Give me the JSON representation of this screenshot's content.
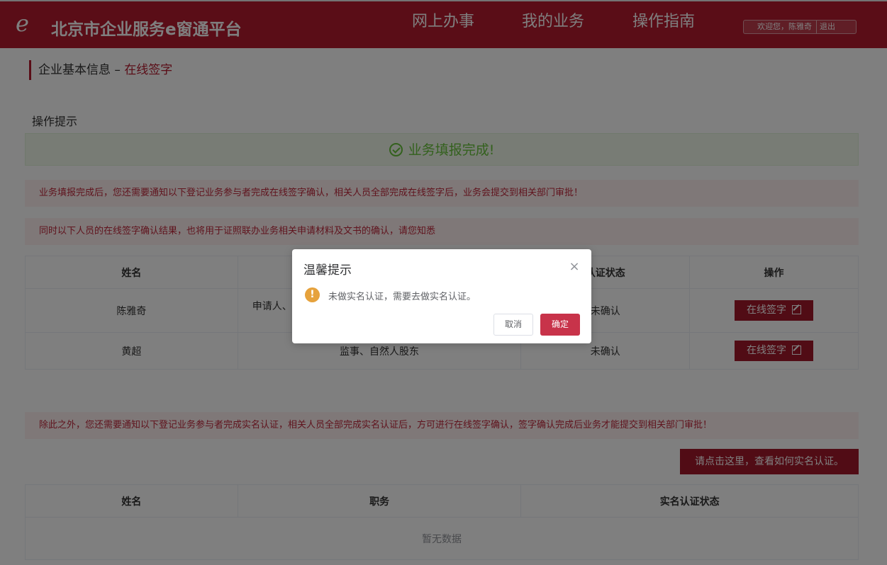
{
  "header": {
    "logo_text": "e",
    "brand": "北京市企业服务e窗通平台",
    "nav": [
      "网上办事",
      "我的业务",
      "操作指南"
    ],
    "welcome": "欢迎您，陈雅奇",
    "logout": "退出"
  },
  "page": {
    "title": "企业基本信息 – ",
    "subtitle": "在线签字",
    "hint_title": "操作提示",
    "success": "业务填报完成!",
    "notice1": "业务填报完成后，您还需要通知以下登记业务参与者完成在线签字确认，相关人员全部完成在线签字后，业务会提交到相关部门审批！",
    "notice2": "同时以下人员的在线签字确认结果，也将用于证照联办业务相关申请材料及文书的确认，请您知悉",
    "notice3": "除此之外，您还需要通知以下登记业务参与者完成实名认证，相关人员全部完成实名认证后，方可进行在线签字确认，签字确认完成后业务才能提交到相关部门审批！",
    "howto_button": "请点击这里，查看如何实名认证。"
  },
  "sign_table": {
    "headers": [
      "姓名",
      "",
      "认证状态",
      "操作"
    ],
    "rows": [
      {
        "name": "陈雅奇",
        "role": "申请人、纟",
        "status": "未确认",
        "action": "在线签字"
      },
      {
        "name": "黄超",
        "role": "监事、自然人股东",
        "status": "未确认",
        "action": "在线签字"
      }
    ]
  },
  "auth_table": {
    "headers": [
      "姓名",
      "职务",
      "实名认证状态"
    ],
    "empty": "暂无数据"
  },
  "dialog": {
    "title": "温馨提示",
    "close": "×",
    "warn_icon": "!",
    "message": "未做实名认证，需要去做实名认证。",
    "cancel": "取消",
    "ok": "确定"
  }
}
